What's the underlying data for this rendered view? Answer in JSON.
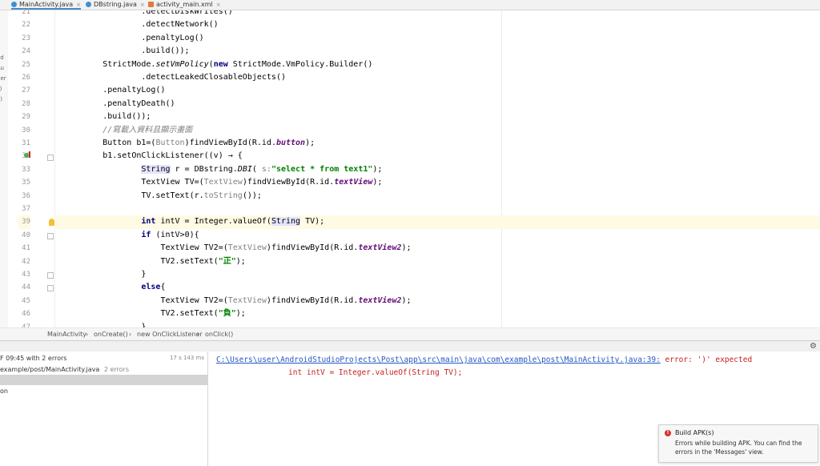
{
  "tabs": [
    {
      "label": "MainActivity.java",
      "icon": "class-icon",
      "active": true
    },
    {
      "label": "DBstring.java",
      "icon": "class-icon",
      "active": false
    },
    {
      "label": "activity_main.xml",
      "icon": "xml-icon",
      "active": false
    }
  ],
  "left_strip_fragments": [
    "ad",
    "Ru",
    "per",
    "s)",
    "o)"
  ],
  "breadcrumb": [
    "MainActivity",
    "onCreate()",
    "new OnClickListener",
    "onClick()"
  ],
  "build_panel": {
    "header": "F 09:45 with 2 errors",
    "time": "17 s 143 ms",
    "file_path": "example/post/MainActivity.java",
    "file_errors": "2 errors",
    "item": "on"
  },
  "messages": {
    "error_link": "C:\\Users\\user\\AndroidStudioProjects\\Post\\app\\src\\main\\java\\com\\example\\post\\MainActivity.java:39:",
    "error_text": " error: ')' expected",
    "code_line": "int intV = Integer.valueOf(String TV);"
  },
  "notification": {
    "title": "Build APK(s)",
    "body_line1": "Errors while building APK. You can find the",
    "body_line2": "errors in the 'Messages' view."
  },
  "colors": {
    "accent": "#4a88c7",
    "error": "#c7221d",
    "link": "#2358c4"
  }
}
